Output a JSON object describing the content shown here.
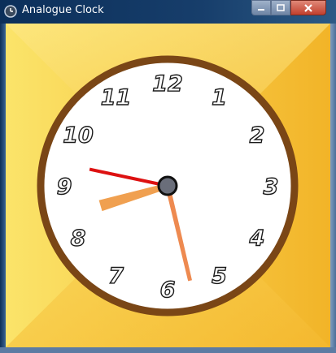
{
  "window": {
    "title": "Analogue Clock"
  },
  "title_bar": {
    "app_icon": "clock-icon",
    "minimize_icon": "minimize-icon",
    "maximize_icon": "maximize-icon",
    "close_icon": "close-icon"
  },
  "clock": {
    "numerals": [
      "12",
      "1",
      "2",
      "3",
      "4",
      "5",
      "6",
      "7",
      "8",
      "9",
      "10",
      "11"
    ],
    "time": {
      "hours": 8,
      "minutes": 27,
      "seconds": 47
    },
    "colors": {
      "background_light": "#fbe46a",
      "background_dark": "#f2b428",
      "rim": "#7a4616",
      "face": "#ffffff",
      "hour_hand": "#f0a050",
      "minute_hand": "#ee8a50",
      "second_hand": "#dd1111",
      "hub": "#6a6e7a"
    }
  }
}
